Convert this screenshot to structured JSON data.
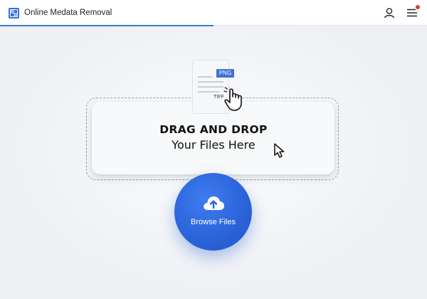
{
  "header": {
    "title": "Online Medata Removal",
    "logo_icon": "app-logo-icon",
    "icons": [
      "user-icon",
      "menu-icon"
    ],
    "notification_color": "#e53935",
    "progress_percent": 50
  },
  "upload": {
    "title": "DRAG AND DROP",
    "subtitle": "Your Files Here",
    "file_tags": {
      "png": "PNG",
      "tiff": "TIFF"
    },
    "browse_label": "Browse Files",
    "browse_icon": "cloud-upload-icon"
  },
  "colors": {
    "accent": "#2a62d9",
    "progress": "#3c78d8",
    "background": "#eef0f4"
  }
}
